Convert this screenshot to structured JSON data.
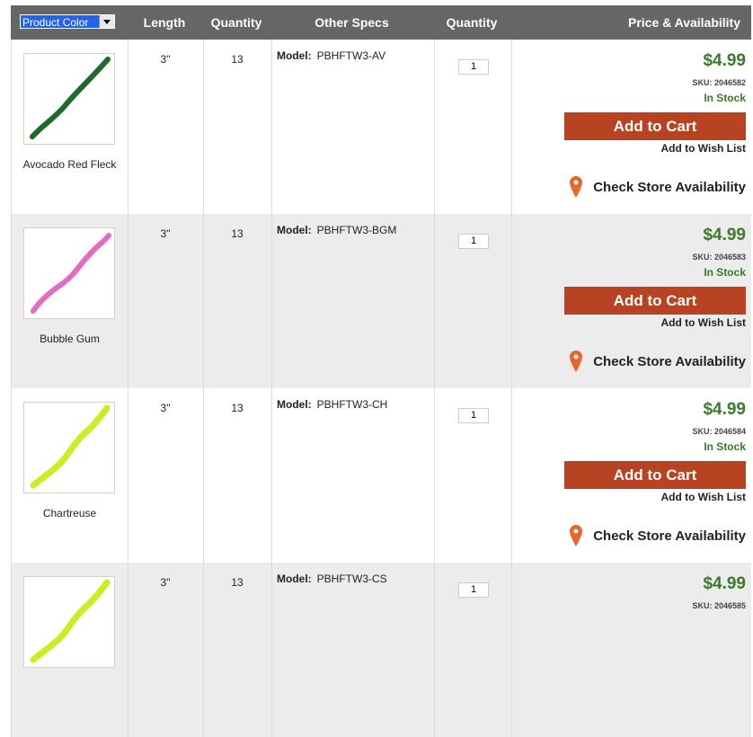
{
  "header": {
    "product_color_select": "Product Color",
    "length": "Length",
    "quantity": "Quantity",
    "other_specs": "Other Specs",
    "quantity2": "Quantity",
    "price_availability": "Price & Availability"
  },
  "labels": {
    "model": "Model:",
    "sku_prefix": "SKU:",
    "add_to_cart": "Add to Cart",
    "add_to_wish_list": "Add to Wish List",
    "check_store": "Check Store Availability"
  },
  "colors": {
    "price_green": "#3a7a2a",
    "cart_orange": "#b84322",
    "pin_orange": "#e8662a",
    "header_gray": "#666666"
  },
  "rows": [
    {
      "color": "Avocado Red Fleck",
      "worm_color": "#1f6b2a",
      "length": "3\"",
      "quantity": "13",
      "model": "PBHFTW3-AV",
      "qty_input": "1",
      "price": "$4.99",
      "sku": "SKU: 2046582",
      "stock": "In Stock"
    },
    {
      "color": "Bubble Gum",
      "worm_color": "#e46bc3",
      "length": "3\"",
      "quantity": "13",
      "model": "PBHFTW3-BGM",
      "qty_input": "1",
      "price": "$4.99",
      "sku": "SKU: 2046583",
      "stock": "In Stock"
    },
    {
      "color": "Chartreuse",
      "worm_color": "#c8f020",
      "length": "3\"",
      "quantity": "13",
      "model": "PBHFTW3-CH",
      "qty_input": "1",
      "price": "$4.99",
      "sku": "SKU: 2046584",
      "stock": "In Stock"
    },
    {
      "color": "",
      "worm_color": "#c8f020",
      "length": "3\"",
      "quantity": "13",
      "model": "PBHFTW3-CS",
      "qty_input": "1",
      "price": "$4.99",
      "sku": "SKU: 2046585",
      "stock": ""
    }
  ]
}
